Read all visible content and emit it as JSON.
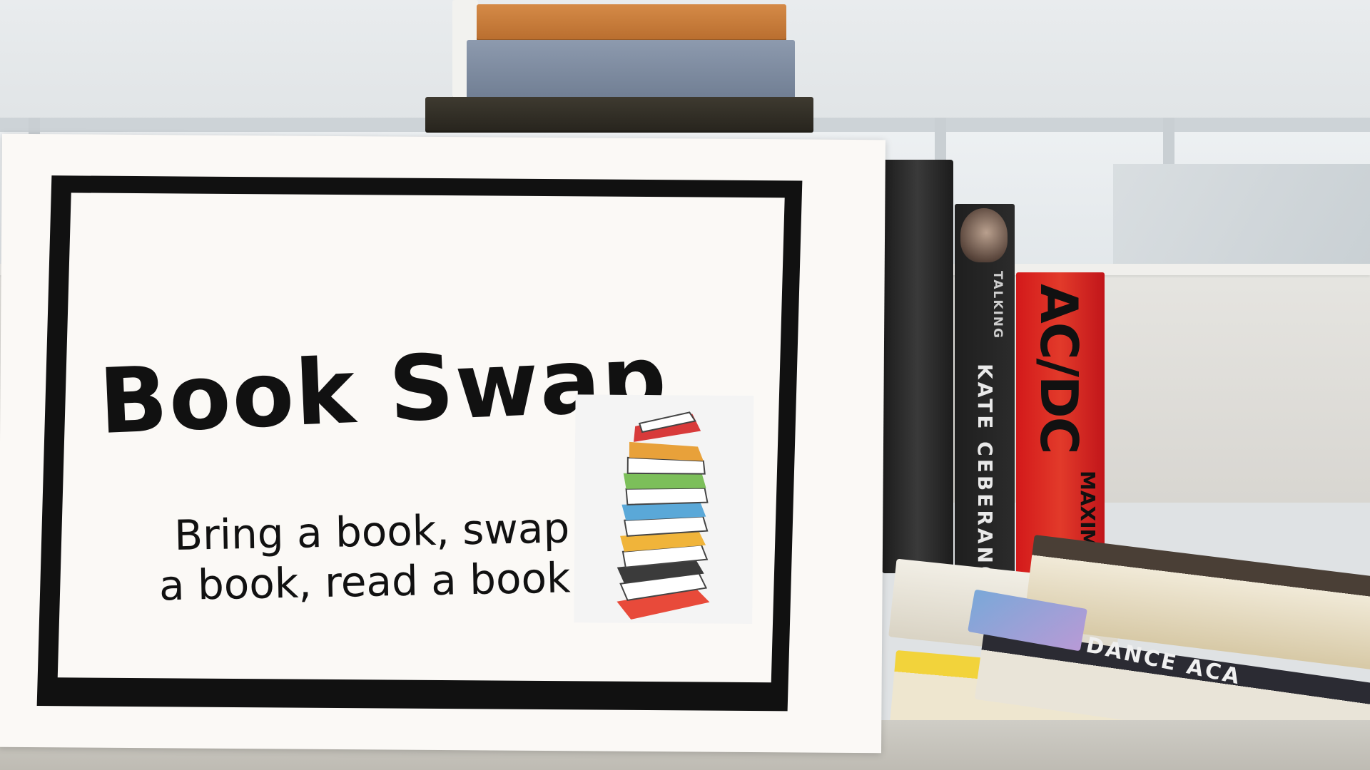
{
  "sign": {
    "title": "Book Swap",
    "subtitle_line1": "Bring a book, swap",
    "subtitle_line2": "a book, read a book"
  },
  "shelf_books": {
    "kate_tag": "TALKING",
    "kate_name": "KATE CEBERANO",
    "acdc_logo": "AC/DC",
    "acdc_sub": "MAXIMUM ROCK & R",
    "dance_title": "DANCE ACA"
  },
  "colors": {
    "sign_border": "#111111",
    "acdc_red": "#d3191a"
  }
}
